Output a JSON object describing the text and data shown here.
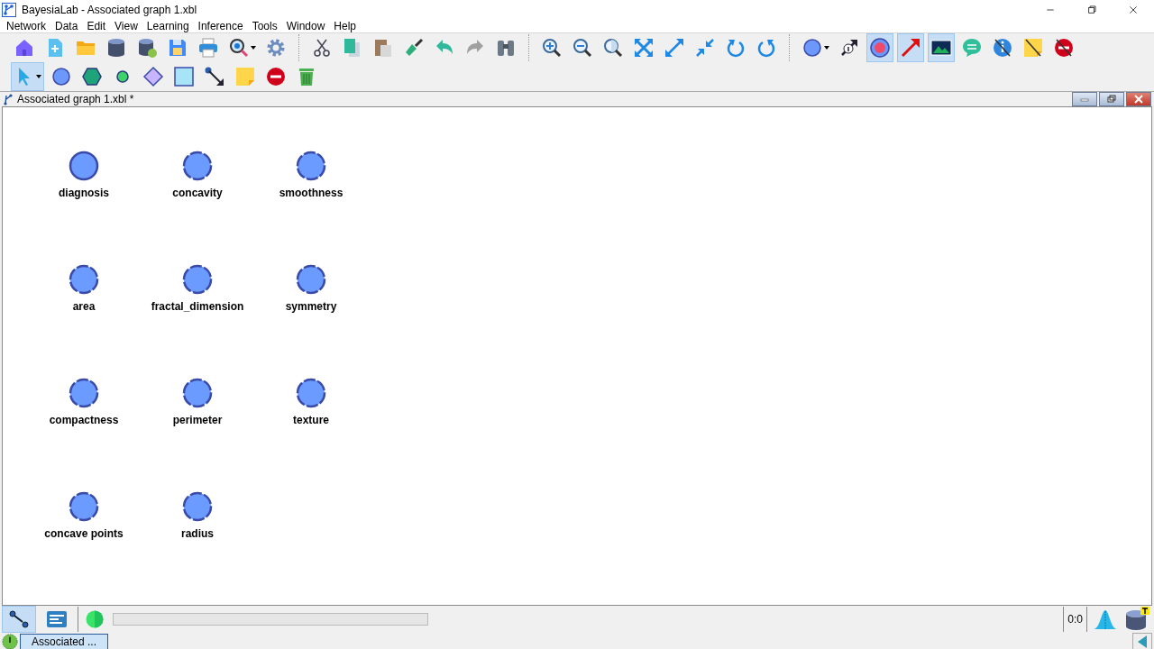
{
  "window": {
    "title": "BayesiaLab - Associated graph 1.xbl"
  },
  "menu": [
    "Network",
    "Data",
    "Edit",
    "View",
    "Learning",
    "Inference",
    "Tools",
    "Window",
    "Help"
  ],
  "toolbar_top": [
    [
      {
        "selected": false
      },
      {
        "selected": false
      },
      {
        "selected": false
      },
      {
        "selected": false
      },
      {
        "selected": false
      },
      {
        "selected": false
      },
      {
        "selected": false
      },
      {
        "selected": false
      },
      {
        "selected": false
      }
    ],
    [
      {
        "selected": false
      },
      {
        "selected": false
      },
      {
        "selected": false
      },
      {
        "selected": false
      },
      {
        "selected": false
      },
      {
        "selected": false
      },
      {
        "selected": false
      }
    ],
    [
      {
        "selected": false
      },
      {
        "selected": false
      },
      {
        "selected": false
      },
      {
        "selected": false
      },
      {
        "selected": false
      },
      {
        "selected": false
      },
      {
        "selected": false
      },
      {
        "selected": false
      }
    ],
    [
      {
        "selected": false
      },
      {
        "selected": false
      },
      {
        "selected": true
      },
      {
        "selected": true
      },
      {
        "selected": true
      },
      {
        "selected": false
      },
      {
        "selected": false
      },
      {
        "selected": false
      },
      {
        "selected": false
      }
    ]
  ],
  "toolbar_tools": [
    {
      "selected": true
    },
    {
      "selected": false
    },
    {
      "selected": false
    },
    {
      "selected": false
    },
    {
      "selected": false
    },
    {
      "selected": false
    },
    {
      "selected": false
    },
    {
      "selected": false
    },
    {
      "selected": false
    },
    {
      "selected": false
    }
  ],
  "document": {
    "title": "Associated graph 1.xbl *"
  },
  "nodes": [
    [
      {
        "label": "diagnosis",
        "kind": "solid"
      },
      {
        "label": "concavity",
        "kind": "dashed"
      },
      {
        "label": "smoothness",
        "kind": "dashed"
      }
    ],
    [
      {
        "label": "area",
        "kind": "dashed"
      },
      {
        "label": "fractal_dimension",
        "kind": "dashed"
      },
      {
        "label": "symmetry",
        "kind": "dashed"
      }
    ],
    [
      {
        "label": "compactness",
        "kind": "dashed"
      },
      {
        "label": "perimeter",
        "kind": "dashed"
      },
      {
        "label": "texture",
        "kind": "dashed"
      }
    ],
    [
      {
        "label": "concave points",
        "kind": "dashed"
      },
      {
        "label": "radius",
        "kind": "dashed"
      }
    ]
  ],
  "status_bar": {
    "modes": [
      {
        "selected": true
      },
      {
        "selected": false
      }
    ],
    "progress": {
      "level": 0
    },
    "counter": "0:0"
  },
  "taskbar": {
    "tab": "Associated ..."
  }
}
